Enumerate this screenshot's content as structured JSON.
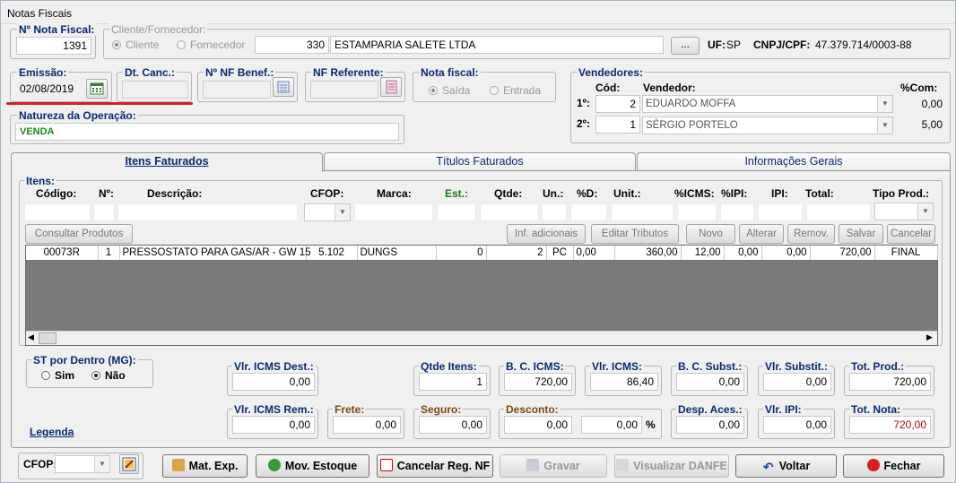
{
  "window": {
    "title": "Notas Fiscais"
  },
  "nota": {
    "label": "Nº Nota Fiscal:",
    "value": "1391"
  },
  "cliente": {
    "group_label": "Cliente/Fornecedor:",
    "radio_cliente": "Cliente",
    "radio_fornecedor": "Fornecedor",
    "code": "330",
    "name": "ESTAMPARIA SALETE LTDA",
    "browse_label": "...",
    "uf_label": "UF:",
    "uf_value": "SP",
    "cnpj_label": "CNPJ/CPF:",
    "cnpj_value": "47.379.714/0003-88"
  },
  "emissao": {
    "label": "Emissão:",
    "value": "02/08/2019"
  },
  "dt_canc": {
    "label": "Dt. Canc.:",
    "value": ""
  },
  "nf_benef": {
    "label": "Nº NF Benef.:",
    "value": ""
  },
  "nf_referente": {
    "label": "NF Referente:",
    "value": ""
  },
  "nota_fiscal_tipo": {
    "label": "Nota fiscal:",
    "saida": "Saída",
    "entrada": "Entrada"
  },
  "vendedores": {
    "label": "Vendedores:",
    "col_cod": "Cód:",
    "col_vendedor": "Vendedor:",
    "col_com": "%Com:",
    "rows": [
      {
        "ord": "1º:",
        "cod": "2",
        "name": "EDUARDO MOFFA",
        "com": "0,00"
      },
      {
        "ord": "2º:",
        "cod": "1",
        "name": "SÉRGIO PORTELO",
        "com": "5,00"
      }
    ]
  },
  "natureza": {
    "label": "Natureza da Operação:",
    "value": "VENDA"
  },
  "tabs": [
    {
      "label": "Itens Faturados"
    },
    {
      "label": "Títulos Faturados"
    },
    {
      "label": "Informações Gerais"
    }
  ],
  "itens": {
    "label": "Itens:",
    "headers": {
      "codigo": "Código:",
      "no": "Nº:",
      "descricao": "Descrição:",
      "cfop": "CFOP:",
      "marca": "Marca:",
      "est": "Est.:",
      "qtde": "Qtde:",
      "un": "Un.:",
      "pd": "%D:",
      "unit": "Unit.:",
      "icms": "%ICMS:",
      "ipi_pct": "%IPI:",
      "ipi": "IPI:",
      "total": "Total:",
      "tipo": "Tipo Prod.:"
    },
    "buttons": {
      "consultar": "Consultar Produtos",
      "inf_adicionais": "Inf. adicionais",
      "editar_tributos": "Editar Tributos",
      "novo": "Novo",
      "alterar": "Alterar",
      "remov": "Remov.",
      "salvar": "Salvar",
      "cancelar": "Cancelar"
    },
    "rows": [
      {
        "codigo": "00073R",
        "no": "1",
        "descricao": "PRESSOSTATO PARA GAS/AR - GW 15",
        "cfop": "5.102",
        "marca": "DUNGS",
        "est": "0",
        "qtde": "2",
        "un": "PC",
        "pd": "0,00",
        "unit": "360,00",
        "icms": "12,00",
        "ipi_pct": "0,00",
        "ipi": "0,00",
        "total": "720,00",
        "tipo": "FINAL"
      }
    ]
  },
  "st_dentro": {
    "label": "ST por Dentro (MG):",
    "sim": "Sim",
    "nao": "Não"
  },
  "totais": {
    "vlr_icms_dest": {
      "label": "Vlr. ICMS Dest.:",
      "value": "0,00"
    },
    "qtde_itens": {
      "label": "Qtde Itens:",
      "value": "1"
    },
    "bc_icms": {
      "label": "B. C. ICMS:",
      "value": "720,00"
    },
    "vlr_icms": {
      "label": "Vlr. ICMS:",
      "value": "86,40"
    },
    "bc_subst": {
      "label": "B. C. Subst.:",
      "value": "0,00"
    },
    "vlr_subst": {
      "label": "Vlr. Substit.:",
      "value": "0,00"
    },
    "tot_prod": {
      "label": "Tot. Prod.:",
      "value": "720,00"
    },
    "vlr_icms_rem": {
      "label": "Vlr. ICMS Rem.:",
      "value": "0,00"
    },
    "frete": {
      "label": "Frete:",
      "value": "0,00"
    },
    "seguro": {
      "label": "Seguro:",
      "value": "0,00"
    },
    "desconto": {
      "label": "Desconto:",
      "value": "0,00",
      "pct": "0,00",
      "pct_sign": "%"
    },
    "desp_aces": {
      "label": "Desp. Aces.:",
      "value": "0,00"
    },
    "vlr_ipi": {
      "label": "Vlr. IPI:",
      "value": "0,00"
    },
    "tot_nota": {
      "label": "Tot. Nota:",
      "value": "720,00"
    }
  },
  "legenda": "Legenda",
  "footer": {
    "cfop_label": "CFOP:",
    "mat_exp": "Mat. Exp.",
    "mov_estoque": "Mov. Estoque",
    "cancelar_reg": "Cancelar Reg. NF",
    "gravar": "Gravar",
    "visualizar": "Visualizar DANFE",
    "voltar": "Voltar",
    "fechar": "Fechar"
  },
  "colors": {
    "accent": "#0a2a6e",
    "highlight_line": "#d42020",
    "total_red": "#c00000",
    "grid_bg": "#7a7a7a"
  }
}
